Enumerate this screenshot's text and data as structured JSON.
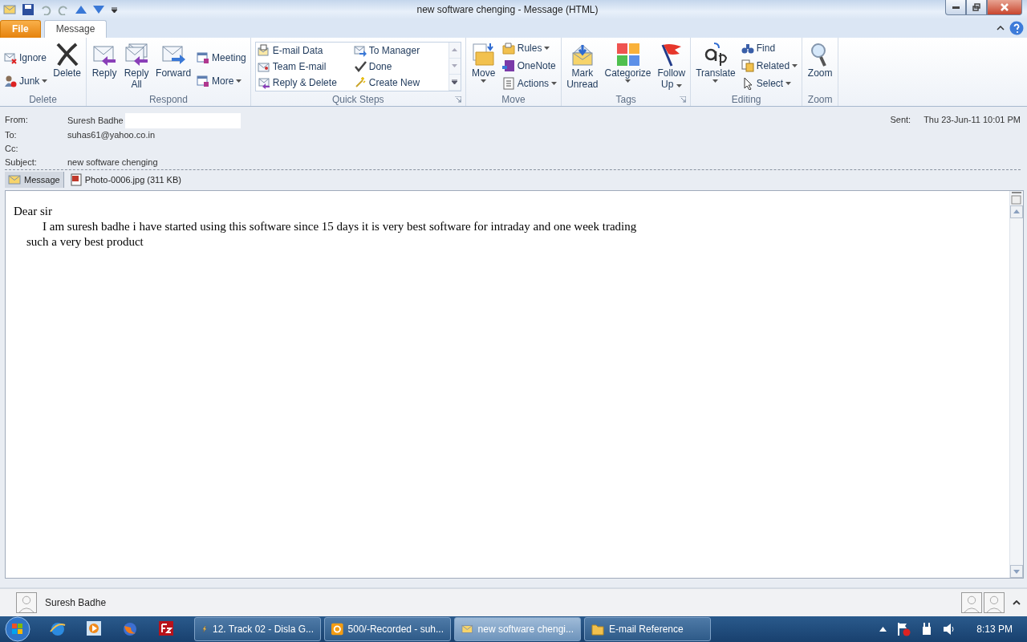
{
  "window": {
    "title": "new software chenging  -  Message (HTML)"
  },
  "ribbon_tabs": [
    {
      "label": "File",
      "kind": "file",
      "selected": false
    },
    {
      "label": "Message",
      "kind": "tab",
      "selected": true
    }
  ],
  "ribbon_groups": [
    {
      "label": "Delete",
      "launcher": false,
      "items": [
        {
          "kind": "small",
          "label": [
            "Ignore"
          ],
          "dropdown": false
        },
        {
          "kind": "small",
          "label": [
            "Junk"
          ],
          "dropdown": true
        },
        {
          "kind": "large",
          "label": [
            "Delete"
          ],
          "dropdown": false
        }
      ]
    },
    {
      "label": "Respond",
      "launcher": false,
      "items": [
        {
          "kind": "large",
          "label": [
            "Reply"
          ],
          "dropdown": false
        },
        {
          "kind": "large",
          "label": [
            "Reply",
            "All"
          ],
          "dropdown": false
        },
        {
          "kind": "large",
          "label": [
            "Forward"
          ],
          "dropdown": false
        },
        {
          "kind": "small",
          "label": [
            "Meeting"
          ],
          "dropdown": false
        },
        {
          "kind": "small",
          "label": [
            "More"
          ],
          "dropdown": true
        }
      ]
    },
    {
      "label": "Quick Steps",
      "launcher": true,
      "items": [
        {
          "kind": "gallery",
          "label": [
            "E-mail Data"
          ],
          "dropdown": false
        },
        {
          "kind": "gallery",
          "label": [
            "To Manager"
          ],
          "dropdown": false
        },
        {
          "kind": "gallery",
          "label": [
            "Team E-mail"
          ],
          "dropdown": false
        },
        {
          "kind": "gallery",
          "label": [
            "Done"
          ],
          "dropdown": false
        },
        {
          "kind": "gallery",
          "label": [
            "Reply & Delete"
          ],
          "dropdown": false
        },
        {
          "kind": "gallery",
          "label": [
            "Create New"
          ],
          "dropdown": false
        }
      ]
    },
    {
      "label": "Move",
      "launcher": false,
      "items": [
        {
          "kind": "large",
          "label": [
            "Move"
          ],
          "dropdown": true
        },
        {
          "kind": "small",
          "label": [
            "Rules"
          ],
          "dropdown": true
        },
        {
          "kind": "small",
          "label": [
            "OneNote"
          ],
          "dropdown": false
        },
        {
          "kind": "small",
          "label": [
            "Actions"
          ],
          "dropdown": true
        }
      ]
    },
    {
      "label": "Tags",
      "launcher": true,
      "items": [
        {
          "kind": "large",
          "label": [
            "Mark",
            "Unread"
          ],
          "dropdown": false
        },
        {
          "kind": "large",
          "label": [
            "Categorize"
          ],
          "dropdown": true
        },
        {
          "kind": "large",
          "label": [
            "Follow",
            "Up"
          ],
          "dropdown": true
        }
      ]
    },
    {
      "label": "Editing",
      "launcher": false,
      "items": [
        {
          "kind": "large",
          "label": [
            "Translate"
          ],
          "dropdown": true
        },
        {
          "kind": "small",
          "label": [
            "Find"
          ],
          "dropdown": false
        },
        {
          "kind": "small",
          "label": [
            "Related"
          ],
          "dropdown": true
        },
        {
          "kind": "small",
          "label": [
            "Select"
          ],
          "dropdown": true
        }
      ]
    },
    {
      "label": "Zoom",
      "launcher": false,
      "items": [
        {
          "kind": "large",
          "label": [
            "Zoom"
          ],
          "dropdown": false
        }
      ]
    }
  ],
  "header": {
    "fields": [
      {
        "label": "From:",
        "value": "Suresh Badhe",
        "redacted": true
      },
      {
        "label": "To:",
        "value": "suhas61@yahoo.co.in",
        "redacted": false
      },
      {
        "label": "Cc:",
        "redacted": false
      },
      {
        "label": "Subject:",
        "value": "new software chenging",
        "redacted": false
      }
    ],
    "sent": {
      "label": "Sent:",
      "value": "Thu 23-Jun-11 10:01 PM"
    }
  },
  "attachments": [
    {
      "label": "Message",
      "kind": "message",
      "selected": true
    },
    {
      "label": "Photo-0006.jpg (311 KB)",
      "kind": "image",
      "selected": false
    }
  ],
  "body": [
    {
      "kind": "greeting",
      "text": "Dear sir"
    },
    {
      "kind": "indented",
      "text": "I am suresh badhe i have started using this software since 15 days it is very best software for intraday and one week trading"
    },
    {
      "kind": "continued",
      "text": "such a very best product"
    }
  ],
  "people_pane": {
    "name": "Suresh Badhe"
  },
  "taskbar": {
    "items": [
      {
        "label": "12. Track 02 - Disla G...",
        "kind": "player",
        "selected": false
      },
      {
        "label": "500/-Recorded - suh...",
        "kind": "outlook",
        "selected": false
      },
      {
        "label": "new software chengi...",
        "kind": "mail",
        "selected": true
      },
      {
        "label": "E-mail Reference",
        "kind": "folder",
        "selected": false
      }
    ],
    "clock": "8:13 PM"
  }
}
